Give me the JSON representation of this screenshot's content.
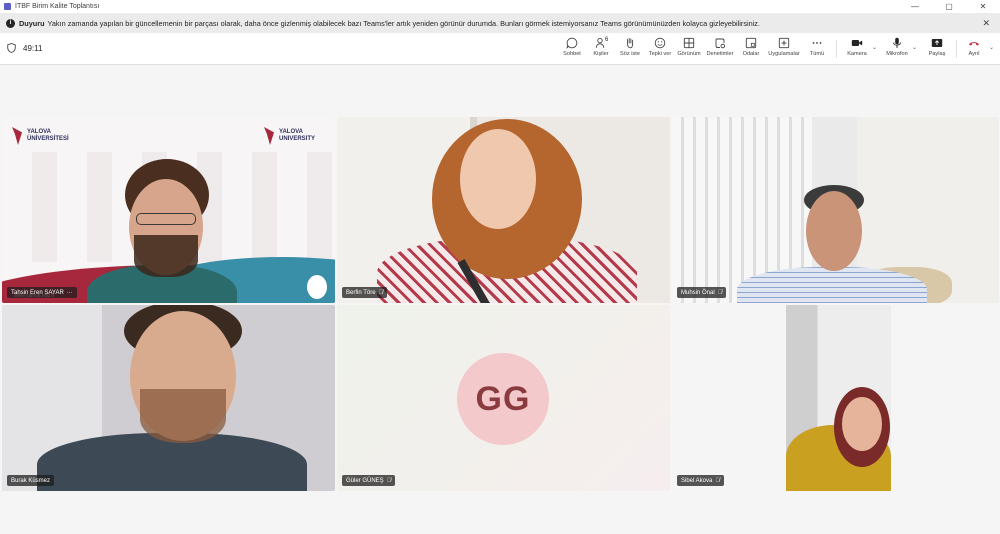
{
  "window": {
    "title": "İTBF Birim Kalite Toplantısı"
  },
  "banner": {
    "title": "Duyuru",
    "message": "Yakın zamanda yapılan bir güncellemenin bir parçası olarak, daha önce gizlenmiş olabilecek bazı Teams'ler artık yeniden görünür durumda. Bunları görmek istemiyorsanız Teams görünümünüzden kolayca gizleyebilirsiniz."
  },
  "toolbar": {
    "timer": "49:11",
    "people_count": "6",
    "buttons": {
      "chat": "Sohbet",
      "people": "Kişiler",
      "raise_hand": "Söz iste",
      "react": "Tepki ver",
      "view": "Görünüm",
      "notes": "Denetimler",
      "rooms": "Odalar",
      "apps": "Uygulamalar",
      "more": "Tümü",
      "camera": "Kamera",
      "mic": "Mikrofon",
      "share": "Paylaş",
      "leave": "Ayrıl"
    }
  },
  "participants": [
    {
      "name": "Tahsin Eren SAYAR"
    },
    {
      "name": "Berfin Töre"
    },
    {
      "name": "Muhsin Önal"
    },
    {
      "name": "Burak Küsmez"
    },
    {
      "name": "Güler GÜNEŞ",
      "initials": "GG"
    },
    {
      "name": "Sibel Akova"
    }
  ],
  "backdrop": {
    "logo_tr_line1": "YALOVA",
    "logo_tr_line2": "ÜNİVERSİTESİ",
    "logo_en_line1": "YALOVA",
    "logo_en_line2": "UNIVERSITY",
    "url": "www.yalova.edu.tr"
  },
  "colors": {
    "accent": "#5b5fc7",
    "leave_red": "#c4314b",
    "avatar_bg": "#f3c9cb",
    "avatar_text": "#8a3b3f"
  }
}
